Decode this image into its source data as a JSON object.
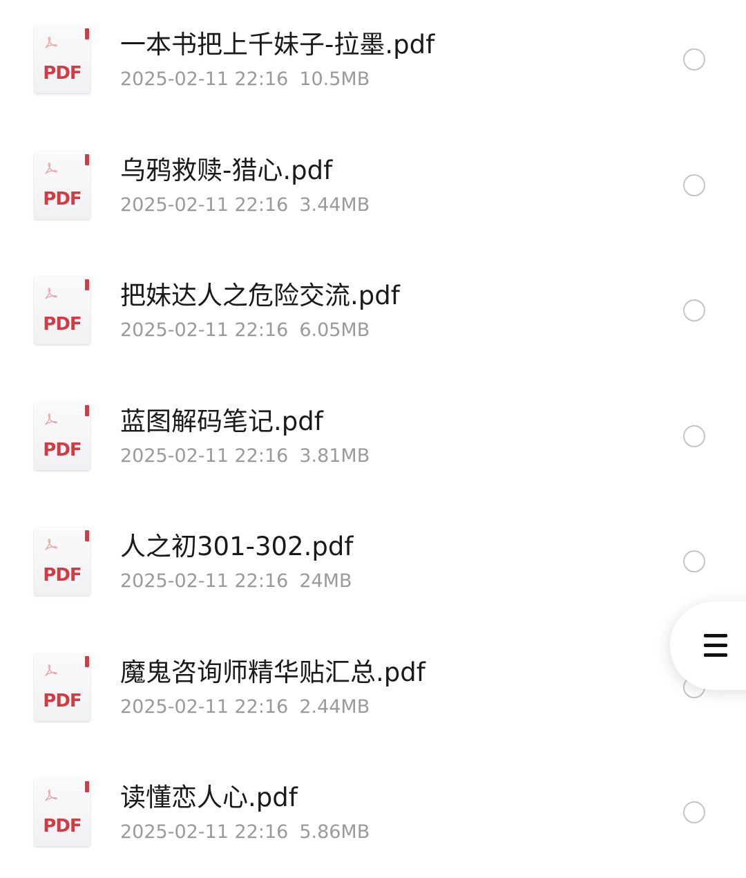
{
  "files": [
    {
      "name": "一本书把上千妹子-拉墨.pdf",
      "date": "2025-02-11 22:16",
      "size": "10.5MB",
      "icon": "pdf-file-icon",
      "icon_label": "PDF"
    },
    {
      "name": "乌鸦救赎-猎心.pdf",
      "date": "2025-02-11 22:16",
      "size": "3.44MB",
      "icon": "pdf-file-icon",
      "icon_label": "PDF"
    },
    {
      "name": "把妹达人之危险交流.pdf",
      "date": "2025-02-11 22:16",
      "size": "6.05MB",
      "icon": "pdf-file-icon",
      "icon_label": "PDF"
    },
    {
      "name": "蓝图解码笔记.pdf",
      "date": "2025-02-11 22:16",
      "size": "3.81MB",
      "icon": "pdf-file-icon",
      "icon_label": "PDF"
    },
    {
      "name": "人之初301-302.pdf",
      "date": "2025-02-11 22:16",
      "size": "24MB",
      "icon": "pdf-file-icon",
      "icon_label": "PDF"
    },
    {
      "name": "魔鬼咨询师精华贴汇总.pdf",
      "date": "2025-02-11 22:16",
      "size": "2.44MB",
      "icon": "pdf-file-icon",
      "icon_label": "PDF"
    },
    {
      "name": "读懂恋人心.pdf",
      "date": "2025-02-11 22:16",
      "size": "5.86MB",
      "icon": "pdf-file-icon",
      "icon_label": "PDF"
    }
  ],
  "floating_menu": {
    "icon": "hamburger-menu-icon"
  },
  "colors": {
    "pdf_red": "#d33a43",
    "file_name": "#1a1a1a",
    "meta_gray": "#9a9a9e",
    "radio_border": "#c4c4c6"
  }
}
